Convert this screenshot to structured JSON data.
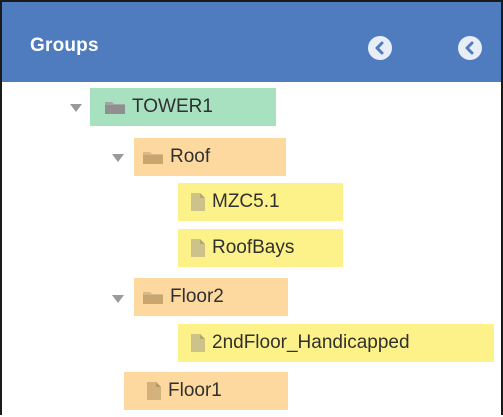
{
  "header": {
    "title": "Groups",
    "buttons": [
      {
        "icon": "chevron-left-icon"
      },
      {
        "icon": "chevron-left-icon"
      }
    ]
  },
  "colors": {
    "header_bg": "#4f7cbf",
    "selected_group": "#a7e1c0",
    "group_highlight": "#fdd9a0",
    "item_highlight": "#fdf18a"
  },
  "tree": {
    "tower1": "TOWER1",
    "roof": "Roof",
    "mzc": "MZC5.1",
    "roofbays": "RoofBays",
    "floor2": "Floor2",
    "handicapped": "2ndFloor_Handicapped",
    "floor1": "Floor1"
  }
}
